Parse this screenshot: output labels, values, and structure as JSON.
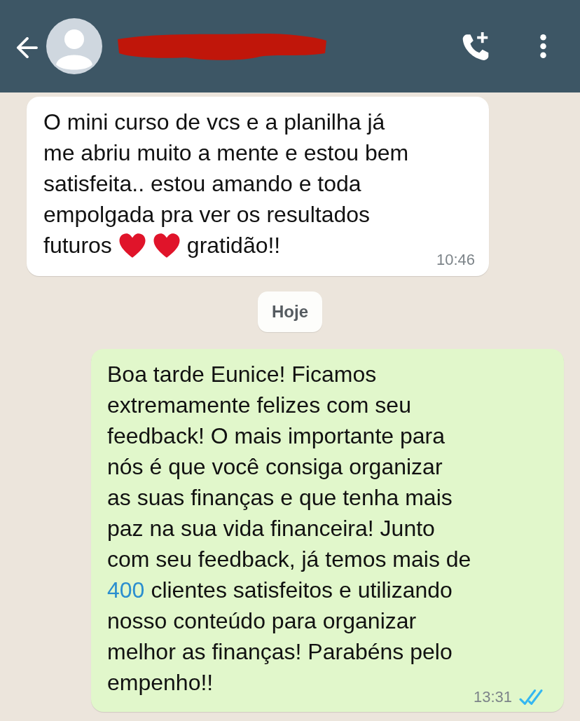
{
  "header": {
    "back": true,
    "avatar": true,
    "name_redacted": true
  },
  "messages": [
    {
      "kind": "incoming",
      "lines": [
        [
          {
            "kind": "text",
            "text": "O mini curso de vcs e a planilha já"
          }
        ],
        [
          {
            "kind": "text",
            "text": "me abriu muito a mente e estou bem"
          }
        ],
        [
          {
            "kind": "text",
            "text": "satisfeita.. estou amando e toda"
          }
        ],
        [
          {
            "kind": "text",
            "text": "empolgada pra ver os resultados"
          }
        ],
        [
          {
            "kind": "text",
            "text": "futuros"
          },
          {
            "kind": "heart"
          },
          {
            "kind": "heart"
          },
          {
            "kind": "text",
            "text": "gratidão!!"
          }
        ]
      ],
      "time": "10:46"
    },
    {
      "kind": "date",
      "label": "Hoje"
    },
    {
      "kind": "outgoing",
      "lines": [
        [
          {
            "kind": "text",
            "text": "Boa tarde Eunice! Ficamos"
          }
        ],
        [
          {
            "kind": "text",
            "text": "extremamente felizes com seu"
          }
        ],
        [
          {
            "kind": "text",
            "text": "feedback! O mais importante para"
          }
        ],
        [
          {
            "kind": "text",
            "text": "nós é que você consiga organizar"
          }
        ],
        [
          {
            "kind": "text",
            "text": "as suas finanças e que tenha mais"
          }
        ],
        [
          {
            "kind": "text",
            "text": "paz na sua vida financeira! Junto"
          }
        ],
        [
          {
            "kind": "text",
            "text": "com seu feedback, já temos mais de"
          }
        ],
        [
          {
            "kind": "link",
            "text": "400"
          },
          {
            "kind": "text",
            "text": "clientes satisfeitos e utilizando"
          }
        ],
        [
          {
            "kind": "text",
            "text": "nosso conteúdo para organizar"
          }
        ],
        [
          {
            "kind": "text",
            "text": "melhor as finanças! Parabéns pelo"
          }
        ],
        [
          {
            "kind": "text",
            "text": "empenho!!"
          }
        ]
      ],
      "time": "13:31",
      "read": true
    }
  ]
}
